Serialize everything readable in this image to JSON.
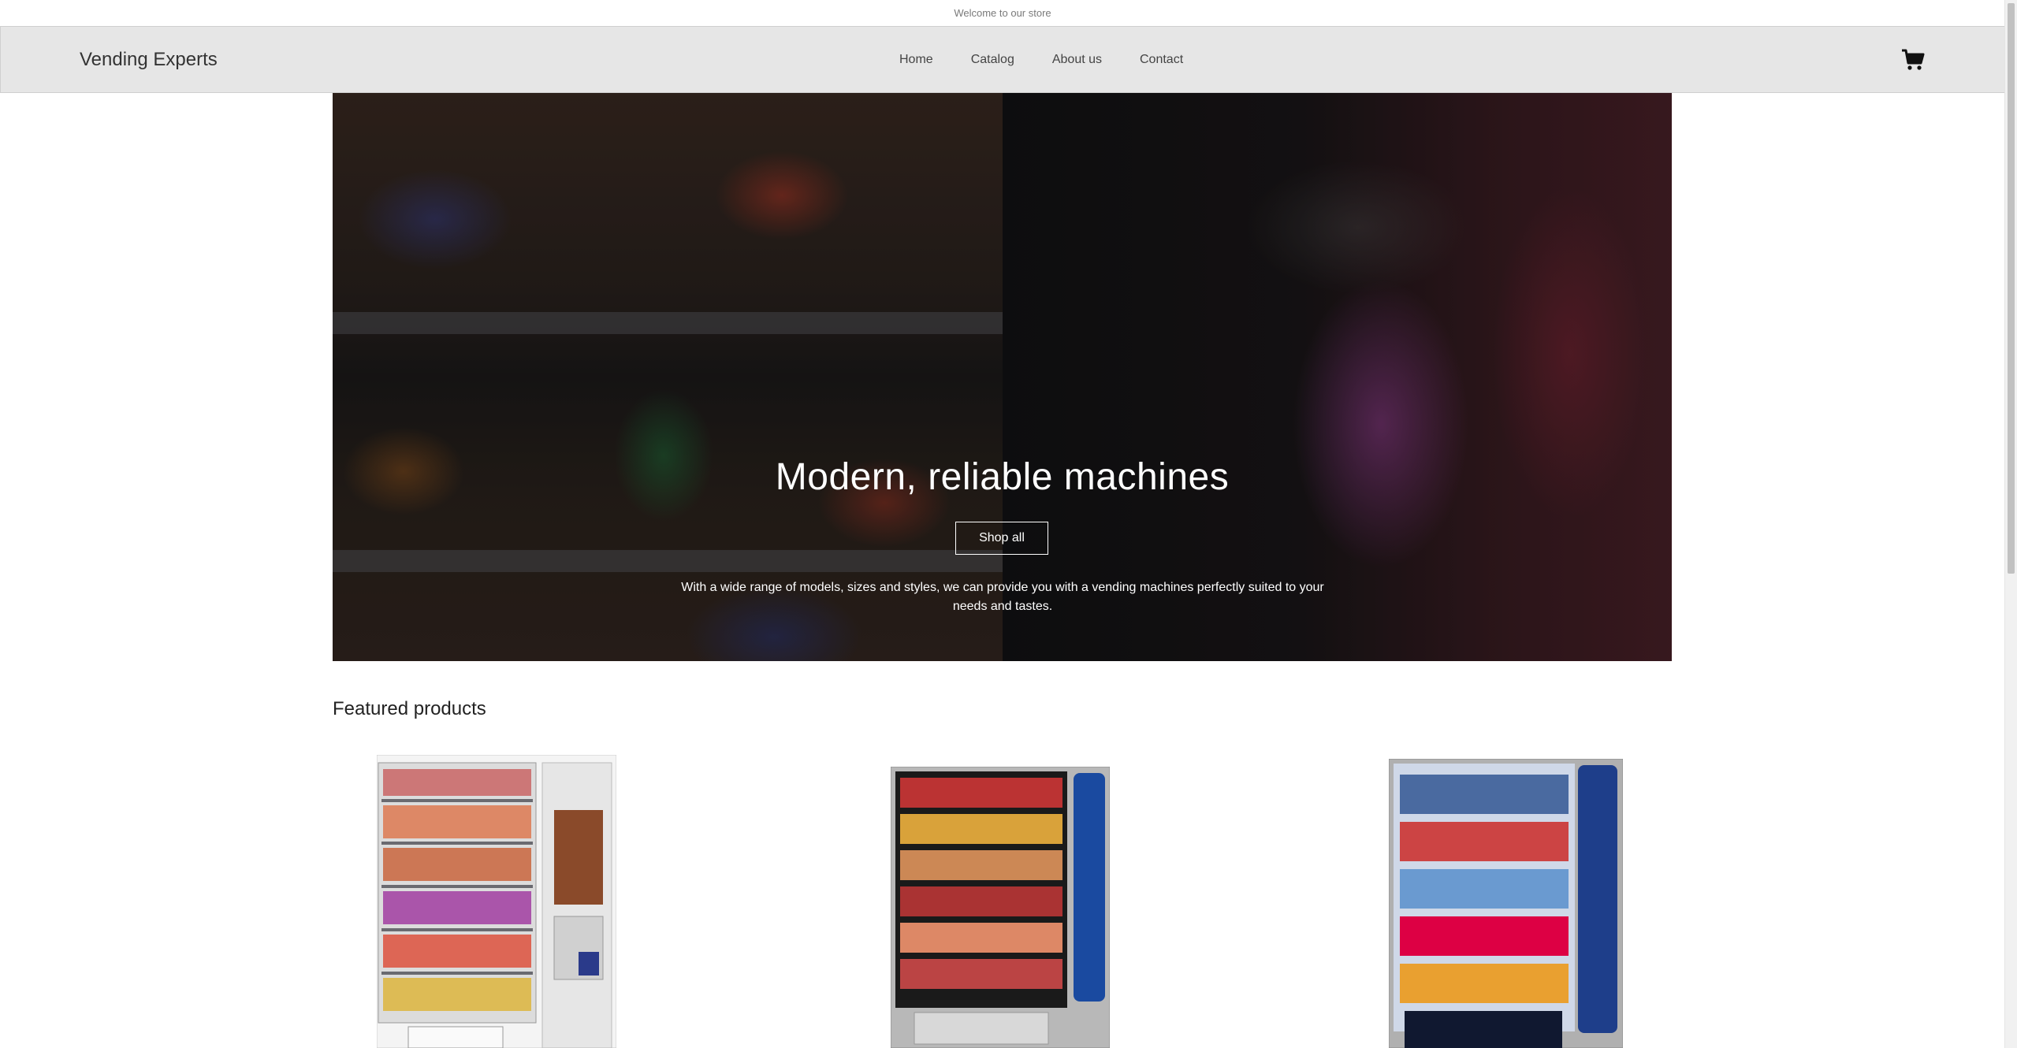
{
  "announcement": "Welcome to our store",
  "header": {
    "brand": "Vending Experts",
    "nav": [
      "Home",
      "Catalog",
      "About us",
      "Contact"
    ],
    "cart_icon": "shopping-cart-icon"
  },
  "hero": {
    "title": "Modern, reliable machines",
    "button_label": "Shop all",
    "description": "With a wide range of models, sizes and styles, we can provide you with a vending machines perfectly suited to your needs and tastes."
  },
  "featured": {
    "title": "Featured products",
    "products": [
      {
        "image": "fresh-food-vending-machine"
      },
      {
        "image": "snack-vending-machine"
      },
      {
        "image": "beverage-vending-machine"
      }
    ]
  },
  "colors": {
    "header_bg": "#e6e6e6",
    "text": "#222222",
    "hero_text": "#ffffff"
  }
}
